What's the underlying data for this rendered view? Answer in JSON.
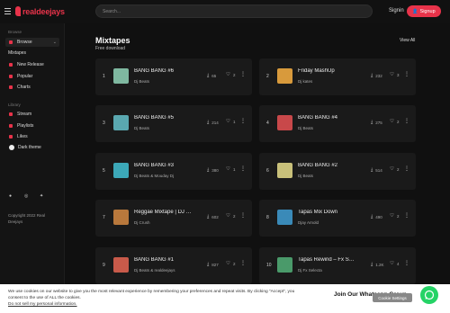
{
  "header": {
    "logo_text": "realdeejays",
    "search_placeholder": "Search...",
    "signin": "Signin",
    "signup": "Signup"
  },
  "sidebar": {
    "browse_label": "Browse",
    "browse_item": "Browse",
    "section_title": "Mixtapes",
    "items": [
      {
        "label": "New Release"
      },
      {
        "label": "Popular"
      },
      {
        "label": "Charts"
      }
    ],
    "library_label": "Library",
    "library": [
      {
        "label": "Stream"
      },
      {
        "label": "Playlists"
      },
      {
        "label": "Likes"
      }
    ],
    "dark_theme": "Dark theme",
    "copyright": "Copyright 2022 Real Deejays"
  },
  "main": {
    "title": "Mixtapes",
    "subtitle": "Free download",
    "view_all": "View All"
  },
  "cards": [
    {
      "num": "1",
      "title": "BANG BANG #6",
      "artist": "Dj Beats",
      "downloads": "65",
      "likes": "2",
      "color": "#7fb8a0"
    },
    {
      "num": "2",
      "title": "Friday MashUp",
      "artist": "Dj kates",
      "downloads": "232",
      "likes": "3",
      "color": "#d89a3c"
    },
    {
      "num": "3",
      "title": "BANG BANG #5",
      "artist": "Dj Beats",
      "downloads": "214",
      "likes": "1",
      "color": "#5aa8b0"
    },
    {
      "num": "4",
      "title": "BANG BANG #4",
      "artist": "Dj Beats",
      "downloads": "275",
      "likes": "2",
      "color": "#c8484a"
    },
    {
      "num": "5",
      "title": "BANG BANG #3",
      "artist": "Dj Beats & Mouday Dj",
      "downloads": "380",
      "likes": "1",
      "color": "#3ca8b8"
    },
    {
      "num": "6",
      "title": "BANG BANG #2",
      "artist": "Dj Beats",
      "downloads": "514",
      "likes": "2",
      "color": "#c8c07a"
    },
    {
      "num": "7",
      "title": "Reggae Mixtape | DJ …",
      "artist": "Dj Crush",
      "downloads": "602",
      "likes": "2",
      "color": "#b8783c"
    },
    {
      "num": "8",
      "title": "Tapas Mix Down",
      "artist": "Djay Arnold",
      "downloads": "490",
      "likes": "2",
      "color": "#3a8ab8"
    },
    {
      "num": "9",
      "title": "BANG BANG #1",
      "artist": "Dj Beats & realdeejays",
      "downloads": "827",
      "likes": "2",
      "color": "#c85a4a"
    },
    {
      "num": "10",
      "title": "Tapas Rewind – Fx S…",
      "artist": "Dj Fx Selecta",
      "downloads": "1.2K",
      "likes": "4",
      "color": "#4a9a6a"
    }
  ],
  "cookie": {
    "text": "We use cookies on our website to give you the most relevant experience by remembering your preferences and repeat visits. By clicking “Accept”, you consent to the use of ALL the cookies.",
    "link": "Do not sell my personal information.",
    "settings": "Cookie Settings",
    "whatsapp": "Join Our Whatsapp Group"
  },
  "colors": {
    "accent": "#e8334a",
    "bg": "#101010",
    "card": "#1a1a1a",
    "whatsapp": "#25d366"
  }
}
